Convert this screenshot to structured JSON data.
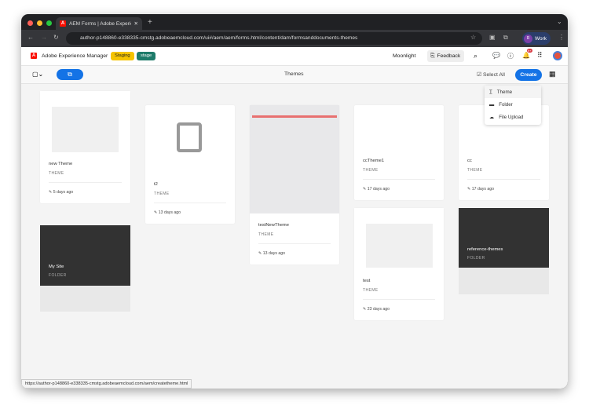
{
  "browser": {
    "tab_title": "AEM Forms | Adobe Experien",
    "url": "author-p148860-e338335-cmstg.adobeaemcloud.com/ui#/aem/aem/forms.html/content/dam/formsanddocuments-themes",
    "profile": "Work",
    "profile_initial": "R"
  },
  "header": {
    "app_name": "Adobe Experience Manager",
    "badges": [
      "Staging",
      "stage"
    ],
    "org": "Moonlight",
    "feedback": "Feedback",
    "notif_count": "9+"
  },
  "toolbar": {
    "title": "Themes",
    "select_all": "Select All",
    "create": "Create"
  },
  "create_menu": [
    "Theme",
    "Folder",
    "File Upload"
  ],
  "cards": [
    {
      "name": "new Theme",
      "type": "THEME",
      "date": "5 days ago"
    },
    {
      "name": "My Site",
      "type": "FOLDER"
    },
    {
      "name": "t2",
      "type": "THEME",
      "date": "13 days ago"
    },
    {
      "name": "testNewTheme",
      "type": "THEME",
      "date": "13 days ago"
    },
    {
      "name": "ccTheme1",
      "type": "THEME",
      "date": "17 days ago"
    },
    {
      "name": "test",
      "type": "THEME",
      "date": "23 days ago"
    },
    {
      "name": "cc",
      "type": "THEME",
      "date": "17 days ago"
    },
    {
      "name": "reference-themes",
      "type": "FOLDER"
    }
  ],
  "status_url": "https://author-p148860-e338335-cmstg.adobeaemcloud.com/aem/createtheme.html"
}
